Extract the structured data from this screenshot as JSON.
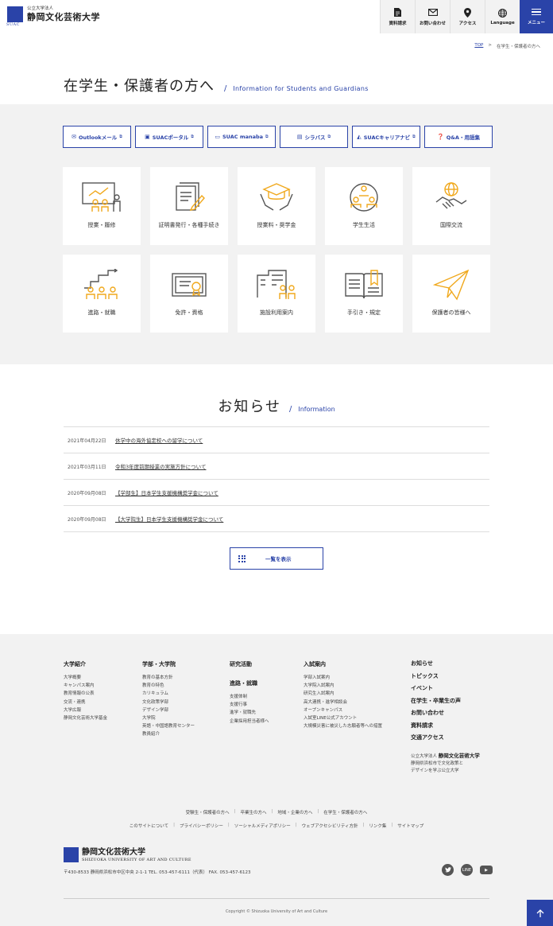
{
  "header": {
    "org_small": "公立大学法人",
    "org_name": "静岡文化芸術大学",
    "logo_mark_text": "SUAC",
    "nav": [
      {
        "label": "資料請求",
        "icon": "document-icon"
      },
      {
        "label": "お問い合わせ",
        "icon": "mail-icon"
      },
      {
        "label": "アクセス",
        "icon": "map-pin-icon"
      },
      {
        "label": "Language",
        "icon": "globe-icon"
      }
    ],
    "menu_label": "メニュー"
  },
  "breadcrumb": {
    "top": "TOP",
    "sep": ">",
    "current": "在学生・保護者の方へ"
  },
  "page": {
    "title": "在学生・保護者の方へ",
    "separator": "/",
    "title_en": "Information for Students and Guardians"
  },
  "quick_links": [
    {
      "label": "Outlookメール",
      "icon": "mail-icon"
    },
    {
      "label": "SUACポータル",
      "icon": "bus-icon"
    },
    {
      "label": "SUAC manaba",
      "icon": "monitor-icon"
    },
    {
      "label": "シラバス",
      "icon": "book-icon"
    },
    {
      "label": "SUACキャリアナビ",
      "icon": "career-icon"
    },
    {
      "label": "Q&A・用語集",
      "icon": "question-icon"
    }
  ],
  "categories": [
    {
      "label": "授業・履修",
      "icon": "lecture-icon"
    },
    {
      "label": "証明書発行・各種手続き",
      "icon": "certificate-document-icon"
    },
    {
      "label": "授業料・奨学金",
      "icon": "graduation-cap-icon"
    },
    {
      "label": "学生生活",
      "icon": "student-life-icon"
    },
    {
      "label": "国際交流",
      "icon": "handshake-globe-icon"
    },
    {
      "label": "進路・就職",
      "icon": "career-steps-icon"
    },
    {
      "label": "免許・資格",
      "icon": "license-certificate-icon"
    },
    {
      "label": "施設利用案内",
      "icon": "facility-icon"
    },
    {
      "label": "手引き・規定",
      "icon": "guidebook-icon"
    },
    {
      "label": "保護者の皆様へ",
      "icon": "paper-plane-icon"
    }
  ],
  "news": {
    "title": "お知らせ",
    "separator": "/",
    "title_en": "Information",
    "items": [
      {
        "date": "2021年04月22日",
        "text": "休学中の海外協定校への留学について"
      },
      {
        "date": "2021年03月11日",
        "text": "令和3年度前期授業の実施方針について"
      },
      {
        "date": "2020年09月08日",
        "text": "【学部生】日本学生支援機構奨学金について"
      },
      {
        "date": "2020年09月08日",
        "text": "【大学院生】日本学生支援機構奨学金について"
      }
    ],
    "more_label": "一覧を表示"
  },
  "footer": {
    "col1": {
      "heading": "大学紹介",
      "items": [
        "大学概要",
        "キャンパス案内",
        "教育情報の公表",
        "交流・連携",
        "大学広報",
        "静岡文化芸術大学基金"
      ]
    },
    "col2": {
      "heading": "学部・大学院",
      "items": [
        "教育の基本方針",
        "教育の特色",
        "カリキュラム",
        "文化政策学部",
        "デザイン学部",
        "大学院",
        "英語・中国語教育センター",
        "教員紹介"
      ]
    },
    "col3": {
      "heading": "研究活動",
      "heading2": "進路・就職",
      "items": [
        "支援体制",
        "支援行事",
        "進学・就職先",
        "企業採用担当者様へ"
      ]
    },
    "col4": {
      "heading": "入試案内",
      "items": [
        "学部入試案内",
        "大学院入試案内",
        "研究生入試案内",
        "高大連携・進学相談会",
        "オープンキャンパス",
        "入試室LINE公式アカウント",
        "大規模災害に被災した志願者等への措置"
      ]
    },
    "col5": {
      "items": [
        "お知らせ",
        "トピックス",
        "イベント",
        "在学生・卒業生の声",
        "お問い合わせ",
        "資料請求",
        "交通アクセス"
      ]
    },
    "corp": {
      "name_prefix": "公立大学法人",
      "name": "静岡文化芸術大学",
      "line1": "静岡県浜松市で文化政策と",
      "line2": "デザインを学ぶ公立大学"
    },
    "links1": [
      "受験生・保護者の方へ",
      "卒業生の方へ",
      "地域・企業の方へ",
      "在学生・保護者の方へ"
    ],
    "links2": [
      "このサイトについて",
      "プライバシーポリシー",
      "ソーシャルメディアポリシー",
      "ウェブアクセシビリティ方針",
      "リンク集",
      "サイトマップ"
    ],
    "logo_jp": "静岡文化芸術大学",
    "logo_en": "SHIZUOKA UNIVERSITY OF ART AND CULTURE",
    "address": "〒430-8533 静岡県浜松市中区中央 2-1-1 TEL. 053-457-6111（代表） FAX. 053-457-6123",
    "social": [
      "twitter-icon",
      "line-icon",
      "youtube-icon"
    ],
    "social_labels": {
      "line": "LINE"
    },
    "copyright": "Copyright © Shizuoka University of Art and Culture"
  },
  "colors": {
    "accent": "#2a43a8",
    "icon_orange": "#f0a81c",
    "gray_bg": "#f2f2f2"
  }
}
